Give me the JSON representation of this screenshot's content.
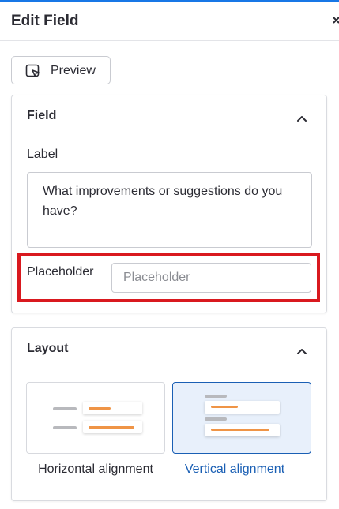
{
  "header": {
    "title": "Edit Field",
    "close_icon": "close-icon"
  },
  "toolbar": {
    "preview_label": "Preview",
    "preview_icon": "preview-icon"
  },
  "field_section": {
    "title": "Field",
    "collapse_icon": "chevron-up-icon",
    "label_caption": "Label",
    "label_value": "What improvements or suggestions do you have?",
    "placeholder_caption": "Placeholder",
    "placeholder_value": "",
    "placeholder_hint": "Placeholder",
    "highlight_color": "#d9191f"
  },
  "layout_section": {
    "title": "Layout",
    "collapse_icon": "chevron-up-icon",
    "options": [
      {
        "label": "Horizontal alignment",
        "selected": false
      },
      {
        "label": "Vertical alignment",
        "selected": true
      }
    ]
  },
  "colors": {
    "accent": "#1877e6",
    "selected_text": "#1a5fb4",
    "selected_bg": "#e8f0fb",
    "thumb_accent": "#ef9446"
  }
}
